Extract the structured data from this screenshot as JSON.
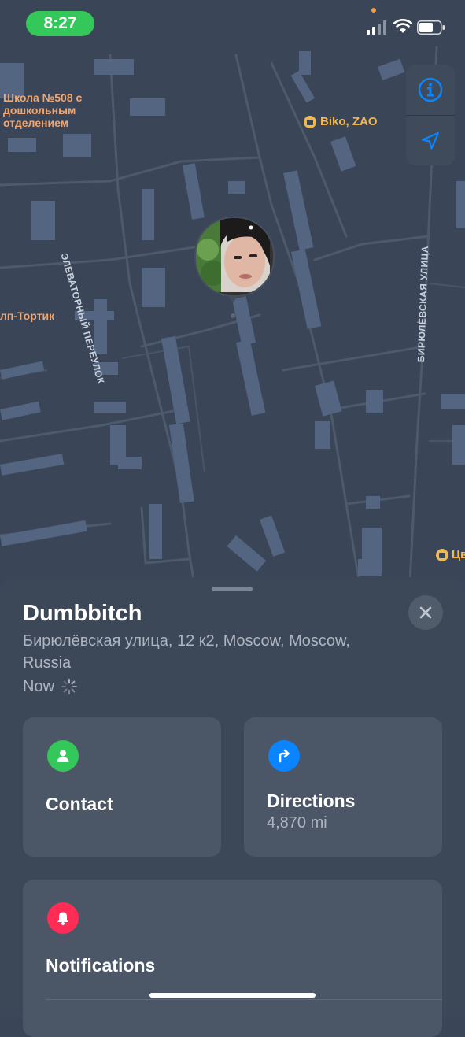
{
  "status_bar": {
    "time": "8:27"
  },
  "map": {
    "poi_school": "Школа №508 с дошкольным отделением",
    "poi_biko": "Biko, ZAO",
    "poi_tortik": "лп-Тортик",
    "poi_right": "Цв",
    "street_1": "ЭЛЕВАТОРНЫЙ ПЕРЕУЛОК",
    "street_2": "БИРЮЛЁВСКАЯ УЛИЦА",
    "info_icon": "info-icon",
    "location_icon": "location-arrow-icon"
  },
  "person": {
    "name": "Dumbbitch",
    "address": "Бирюлёвская улица, 12 к2, Moscow, Moscow, Russia",
    "updated": "Now"
  },
  "actions": {
    "contact": {
      "label": "Contact",
      "icon": "person-icon",
      "color": "#34c759"
    },
    "directions": {
      "label": "Directions",
      "distance": "4,870 mi",
      "icon": "turn-right-arrow-icon",
      "color": "#0a84ff"
    },
    "notifications": {
      "label": "Notifications",
      "icon": "bell-icon",
      "color": "#ff2d55"
    }
  },
  "colors": {
    "map_background": "#3a4658",
    "sheet_background": "#3c4757",
    "card_background": "#4b5666",
    "accent_blue": "#0a84ff"
  }
}
